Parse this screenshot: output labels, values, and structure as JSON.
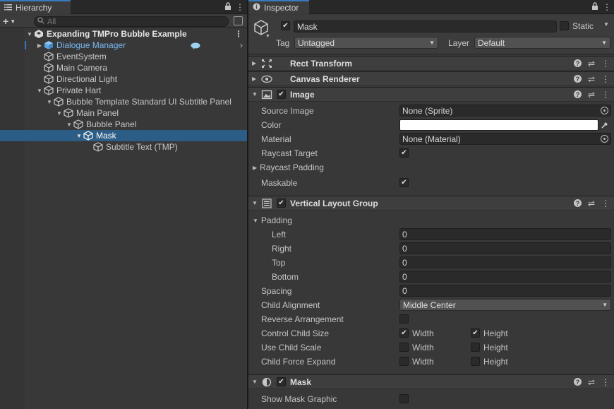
{
  "hierarchy": {
    "tab_label": "Hierarchy",
    "search_placeholder": "All",
    "items": [
      {
        "label": "Expanding TMPro Bubble Example"
      },
      {
        "label": "Dialogue Manager"
      },
      {
        "label": "EventSystem"
      },
      {
        "label": "Main Camera"
      },
      {
        "label": "Directional Light"
      },
      {
        "label": "Private Hart"
      },
      {
        "label": "Bubble Template Standard UI Subtitle Panel"
      },
      {
        "label": "Main Panel"
      },
      {
        "label": "Bubble Panel"
      },
      {
        "label": "Mask"
      },
      {
        "label": "Subtitle Text (TMP)"
      }
    ]
  },
  "inspector": {
    "tab_label": "Inspector",
    "object_name": "Mask",
    "static_label": "Static",
    "tag_label": "Tag",
    "tag_value": "Untagged",
    "layer_label": "Layer",
    "layer_value": "Default",
    "components": {
      "rect_transform": "Rect Transform",
      "canvas_renderer": "Canvas Renderer",
      "image": {
        "title": "Image",
        "source_image_label": "Source Image",
        "source_image_value": "None (Sprite)",
        "color_label": "Color",
        "color_value": "#ffffff",
        "material_label": "Material",
        "material_value": "None (Material)",
        "raycast_target_label": "Raycast Target",
        "raycast_padding_label": "Raycast Padding",
        "maskable_label": "Maskable"
      },
      "vlg": {
        "title": "Vertical Layout Group",
        "padding_label": "Padding",
        "left_label": "Left",
        "left_value": "0",
        "right_label": "Right",
        "right_value": "0",
        "top_label": "Top",
        "top_value": "0",
        "bottom_label": "Bottom",
        "bottom_value": "0",
        "spacing_label": "Spacing",
        "spacing_value": "0",
        "child_alignment_label": "Child Alignment",
        "child_alignment_value": "Middle Center",
        "reverse_label": "Reverse Arrangement",
        "control_size_label": "Control Child Size",
        "use_scale_label": "Use Child Scale",
        "force_expand_label": "Child Force Expand",
        "width_label": "Width",
        "height_label": "Height"
      },
      "mask": {
        "title": "Mask",
        "show_graphic_label": "Show Mask Graphic"
      }
    }
  }
}
